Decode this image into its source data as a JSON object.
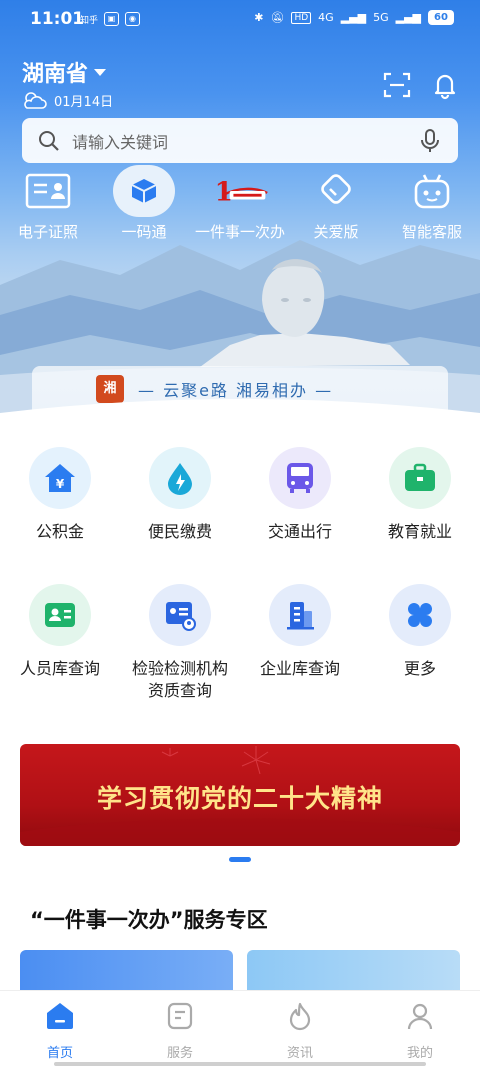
{
  "status_bar": {
    "time": "11:01",
    "network": "4G",
    "network2": "5G",
    "battery": "60"
  },
  "header": {
    "province": "湖南省",
    "date": "01月14日",
    "scan_icon": "scan-icon",
    "bell_icon": "bell-icon"
  },
  "search": {
    "placeholder": "请输入关键词"
  },
  "quick_links": [
    {
      "label": "电子证照",
      "icon": "id-card-icon"
    },
    {
      "label": "一码通",
      "icon": "cube-icon"
    },
    {
      "label": "一件事一次办",
      "icon": "one-thing-logo"
    },
    {
      "label": "关爱版",
      "icon": "heart-tag-icon"
    },
    {
      "label": "智能客服",
      "icon": "robot-icon"
    }
  ],
  "slogan": {
    "logo_text": "湘",
    "text": "— 云聚e路 湘易相办 —"
  },
  "services": [
    {
      "label": "公积金",
      "icon": "house-yen-icon"
    },
    {
      "label": "便民缴费",
      "icon": "water-bolt-icon"
    },
    {
      "label": "交通出行",
      "icon": "bus-icon"
    },
    {
      "label": "教育就业",
      "icon": "briefcase-icon"
    },
    {
      "label": "人员库查询",
      "icon": "person-card-icon"
    },
    {
      "label": "检验检测机构资质查询",
      "icon": "certificate-icon"
    },
    {
      "label": "企业库查询",
      "icon": "building-icon"
    },
    {
      "label": "更多",
      "icon": "more-grid-icon"
    }
  ],
  "banner": {
    "text": "学习贯彻党的二十大精神"
  },
  "section": {
    "title": "“一件事一次办”服务专区"
  },
  "tabs": [
    {
      "label": "首页",
      "active": true
    },
    {
      "label": "服务",
      "active": false
    },
    {
      "label": "资讯",
      "active": false
    },
    {
      "label": "我的",
      "active": false
    }
  ],
  "colors": {
    "primary": "#2b7cf0",
    "banner_red": "#c5171b",
    "banner_text": "#ffe48a"
  }
}
